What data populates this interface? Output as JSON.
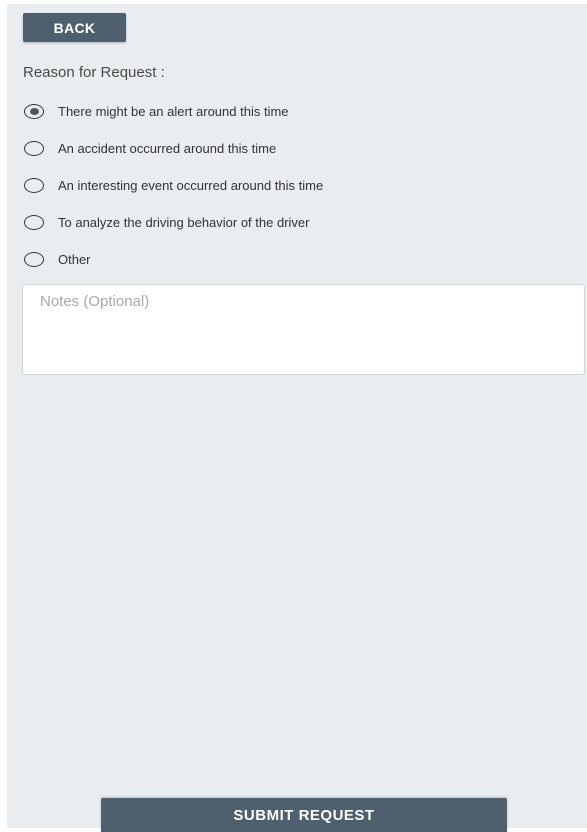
{
  "header": {
    "back_label": "BACK"
  },
  "form": {
    "reason_heading": "Reason for Request :",
    "selected_index": 0,
    "options": [
      {
        "label": "There might be an alert around this time",
        "selected": true
      },
      {
        "label": "An accident occurred around this time",
        "selected": false
      },
      {
        "label": "An interesting event occurred around this time",
        "selected": false
      },
      {
        "label": "To analyze the driving behavior of the driver",
        "selected": false
      },
      {
        "label": "Other",
        "selected": false
      }
    ],
    "notes": {
      "placeholder": "Notes (Optional)",
      "value": ""
    }
  },
  "footer": {
    "submit_label": "SUBMIT REQUEST"
  },
  "colors": {
    "panel_background": "#eaedf0",
    "button_background": "#4e5f6d",
    "button_text": "#ffffff"
  }
}
